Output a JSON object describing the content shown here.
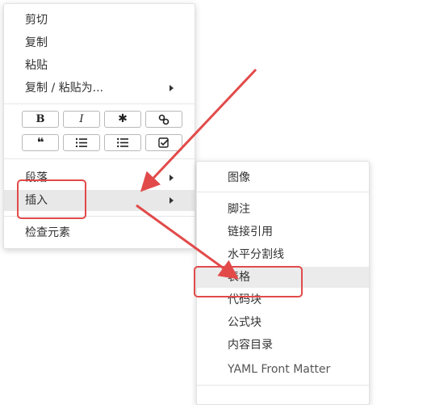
{
  "main_menu": {
    "items": [
      {
        "label": "剪切"
      },
      {
        "label": "复制"
      },
      {
        "label": "粘贴"
      },
      {
        "label": "复制 / 粘贴为..."
      }
    ],
    "format_buttons": [
      {
        "icon": "bold-icon",
        "text": "B"
      },
      {
        "icon": "italic-icon",
        "text": "I"
      },
      {
        "icon": "asterisk-icon",
        "text": "✱"
      },
      {
        "icon": "link-icon"
      },
      {
        "icon": "quote-icon",
        "text": "❝"
      },
      {
        "icon": "ordered-list-icon"
      },
      {
        "icon": "unordered-list-icon"
      },
      {
        "icon": "task-list-icon"
      }
    ],
    "paragraph_label": "段落",
    "insert_label": "插入",
    "inspect_label": "检查元素"
  },
  "submenu": {
    "items": [
      {
        "label": "图像"
      },
      {
        "label": "脚注"
      },
      {
        "label": "链接引用"
      },
      {
        "label": "水平分割线"
      },
      {
        "label": "表格"
      },
      {
        "label": "代码块"
      },
      {
        "label": "公式块"
      },
      {
        "label": "内容目录"
      },
      {
        "label": "YAML Front Matter"
      }
    ]
  },
  "annotation_color": "#e24a4a"
}
